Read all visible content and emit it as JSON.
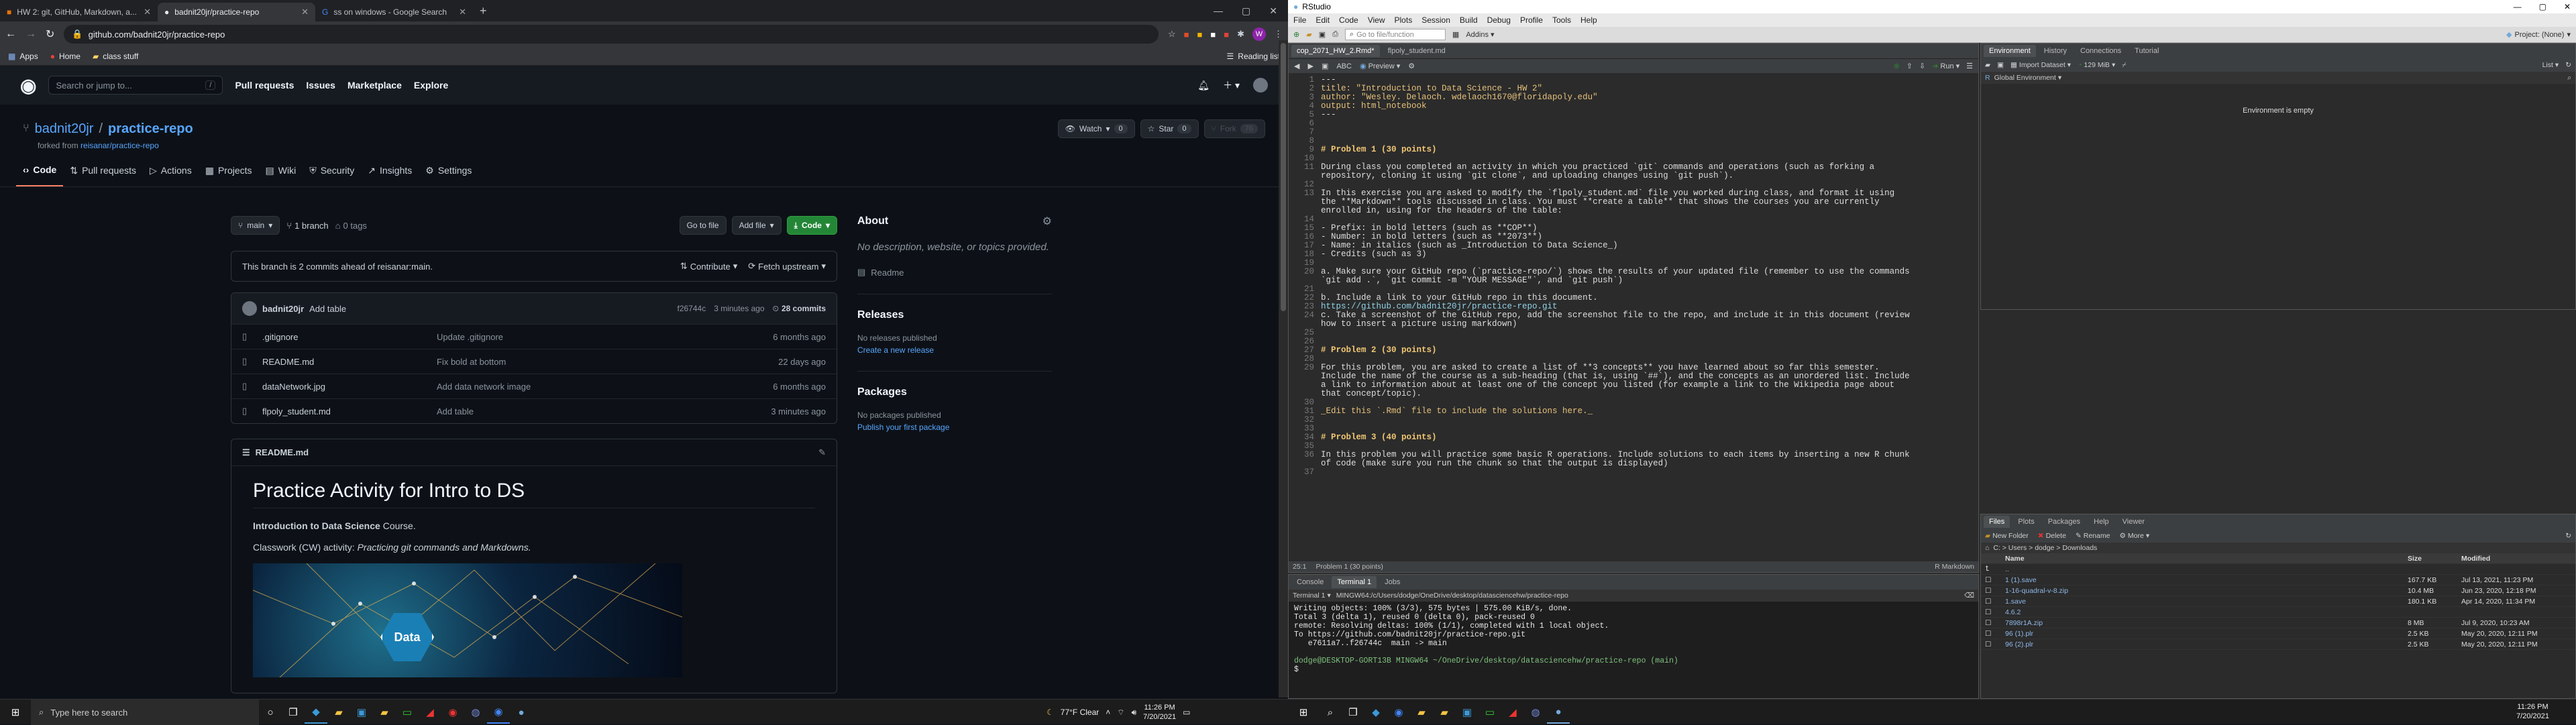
{
  "chrome": {
    "tabs": [
      {
        "label": "HW 2: git, GitHub, Markdown, a..."
      },
      {
        "label": "badnit20jr/practice-repo"
      },
      {
        "label": "ss on windows - Google Search"
      }
    ],
    "url": "github.com/badnit20jr/practice-repo",
    "bookmarks": [
      "Apps",
      "Home",
      "class stuff"
    ],
    "reading_list": "Reading list"
  },
  "gh": {
    "search_placeholder": "Search or jump to...",
    "search_key": "/",
    "nav": [
      "Pull requests",
      "Issues",
      "Marketplace",
      "Explore"
    ],
    "owner": "badnit20jr",
    "sep": "/",
    "repo": "practice-repo",
    "forked_prefix": "forked from",
    "forked_from": "reisanar/practice-repo",
    "watch": "Watch",
    "watch_count": "0",
    "star": "Star",
    "star_count": "0",
    "fork": "Fork",
    "fork_count": "76",
    "tabs": [
      "Code",
      "Pull requests",
      "Actions",
      "Projects",
      "Wiki",
      "Security",
      "Insights",
      "Settings"
    ],
    "branch": "main",
    "branches": "1 branch",
    "tags": "0 tags",
    "goto": "Go to file",
    "addfile": "Add file",
    "code": "Code",
    "ahead": "This branch is 2 commits ahead of reisanar:main.",
    "contribute": "Contribute",
    "fetch": "Fetch upstream",
    "commit_user": "badnit20jr",
    "commit_msg": "Add table",
    "commit_hash": "f26744c",
    "commit_time": "3 minutes ago",
    "commits": "28 commits",
    "files": [
      {
        "name": ".gitignore",
        "msg": "Update .gitignore",
        "time": "6 months ago"
      },
      {
        "name": "README.md",
        "msg": "Fix bold at bottom",
        "time": "22 days ago"
      },
      {
        "name": "dataNetwork.jpg",
        "msg": "Add data network image",
        "time": "6 months ago"
      },
      {
        "name": "flpoly_student.md",
        "msg": "Add table",
        "time": "3 minutes ago"
      }
    ],
    "readme_name": "README.md",
    "readme_h1": "Practice Activity for Intro to DS",
    "readme_p1_bold": "Introduction to Data Science",
    "readme_p1_rest": " Course.",
    "readme_p2_a": "Classwork (CW) activity: ",
    "readme_p2_em": "Practicing git commands and Markdowns.",
    "about": "About",
    "about_desc": "No description, website, or topics provided.",
    "readme_link": "Readme",
    "releases": "Releases",
    "no_releases": "No releases published",
    "create_release": "Create a new release",
    "packages": "Packages",
    "no_packages": "No packages published",
    "publish_pkg": "Publish your first package",
    "img_label": "Data"
  },
  "rs": {
    "title": "RStudio",
    "menu": [
      "File",
      "Edit",
      "Code",
      "View",
      "Plots",
      "Session",
      "Build",
      "Debug",
      "Profile",
      "Tools",
      "Help"
    ],
    "goto": "Go to file/function",
    "addins": "Addins",
    "project": "Project: (None)",
    "editor_tabs": [
      "cop_2071_HW_2.Rmd*",
      "flpoly_student.md"
    ],
    "preview": "Preview",
    "run": "Run",
    "lines": [
      {
        "n": "1",
        "t": "---",
        "c": ""
      },
      {
        "n": "2",
        "t": "title: \"Introduction to Data Science - HW 2\"",
        "c": "yl"
      },
      {
        "n": "3",
        "t": "author: \"Wesley. Delaoch. wdelaoch1670@floridapoly.edu\"",
        "c": "yl"
      },
      {
        "n": "4",
        "t": "output: html_notebook",
        "c": "yl"
      },
      {
        "n": "5",
        "t": "---",
        "c": ""
      },
      {
        "n": "6",
        "t": "",
        "c": ""
      },
      {
        "n": "7",
        "t": "",
        "c": ""
      },
      {
        "n": "8",
        "t": "",
        "c": ""
      },
      {
        "n": "9",
        "t": "# Problem 1 (30 points)",
        "c": "h"
      },
      {
        "n": "10",
        "t": "",
        "c": ""
      },
      {
        "n": "11",
        "t": "During class you completed an activity in which you practiced `git` commands and operations (such as forking a",
        "c": ""
      },
      {
        "n": "",
        "t": "repository, cloning it using `git clone`, and uploading changes using `git push`).",
        "c": ""
      },
      {
        "n": "12",
        "t": "",
        "c": ""
      },
      {
        "n": "13",
        "t": "In this exercise you are asked to modify the `flpoly_student.md` file you worked during class, and format it using",
        "c": ""
      },
      {
        "n": "",
        "t": "the **Markdown** tools discussed in class. You must **create a table** that shows the courses you are currently",
        "c": ""
      },
      {
        "n": "",
        "t": "enrolled in, using for the headers of the table:",
        "c": ""
      },
      {
        "n": "14",
        "t": "",
        "c": ""
      },
      {
        "n": "15",
        "t": "- Prefix: in bold letters (such as **COP**)",
        "c": ""
      },
      {
        "n": "16",
        "t": "- Number: in bold letters (such as **2073**)",
        "c": ""
      },
      {
        "n": "17",
        "t": "- Name: in italics (such as _Introduction to Data Science_)",
        "c": ""
      },
      {
        "n": "18",
        "t": "- Credits (such as 3)",
        "c": ""
      },
      {
        "n": "19",
        "t": "",
        "c": ""
      },
      {
        "n": "20",
        "t": "a. Make sure your GitHub repo (`practice-repo/`) shows the results of your updated file (remember to use the commands",
        "c": ""
      },
      {
        "n": "",
        "t": "`git add .`, `git commit -m \"YOUR MESSAGE\"`, and `git push`)",
        "c": ""
      },
      {
        "n": "21",
        "t": "",
        "c": ""
      },
      {
        "n": "22",
        "t": "b. Include a link to your GitHub repo in this document.",
        "c": ""
      },
      {
        "n": "23",
        "t": "https://github.com/badnit20jr/practice-repo.git",
        "c": "cy"
      },
      {
        "n": "24",
        "t": "c. Take a screenshot of the GitHub repo, add the screenshot file to the repo, and include it in this document (review",
        "c": ""
      },
      {
        "n": "",
        "t": "how to insert a picture using markdown)",
        "c": ""
      },
      {
        "n": "25",
        "t": "",
        "c": ""
      },
      {
        "n": "26",
        "t": "",
        "c": ""
      },
      {
        "n": "27",
        "t": "# Problem 2 (30 points)",
        "c": "h"
      },
      {
        "n": "28",
        "t": "",
        "c": ""
      },
      {
        "n": "29",
        "t": "For this problem, you are asked to create a list of **3 concepts** you have learned about so far this semester.",
        "c": ""
      },
      {
        "n": "",
        "t": "Include the name of the course as a sub-heading (that is, using `##`), and the concepts as an unordered list. Include",
        "c": ""
      },
      {
        "n": "",
        "t": "a link to information about at least one of the concept you listed (for example a link to the Wikipedia page about",
        "c": ""
      },
      {
        "n": "",
        "t": "that concept/topic).",
        "c": ""
      },
      {
        "n": "30",
        "t": "",
        "c": ""
      },
      {
        "n": "31",
        "t": "_Edit this `.Rmd` file to include the solutions here._",
        "c": "yl"
      },
      {
        "n": "32",
        "t": "",
        "c": ""
      },
      {
        "n": "33",
        "t": "",
        "c": ""
      },
      {
        "n": "34",
        "t": "# Problem 3 (40 points)",
        "c": "h"
      },
      {
        "n": "35",
        "t": "",
        "c": ""
      },
      {
        "n": "36",
        "t": "In this problem you will practice some basic R operations. Include solutions to each items by inserting a new R chunk",
        "c": ""
      },
      {
        "n": "",
        "t": "of code (make sure you run the chunk so that the output is displayed)",
        "c": ""
      },
      {
        "n": "37",
        "t": "",
        "c": ""
      }
    ],
    "editor_status_left": "25:1",
    "editor_status_mid": "Problem 1 (30 points)",
    "editor_status_right": "R Markdown",
    "console_tabs": [
      "Console",
      "Terminal 1",
      "Jobs"
    ],
    "term_tab": "Terminal 1",
    "term_path": "MINGW64:/c/Users/dodge/OneDrive/desktop/datasciencehw/practice-repo",
    "term_lines": [
      "Writing objects: 100% (3/3), 575 bytes | 575.00 KiB/s, done.",
      "Total 3 (delta 1), reused 0 (delta 0), pack-reused 0",
      "remote: Resolving deltas: 100% (1/1), completed with 1 local object.",
      "To https://github.com/badnit20jr/practice-repo.git",
      "   e7611a7..f26744c  main -> main",
      "",
      "dodge@DESKTOP-GORT13B MINGW64 ~/OneDrive/desktop/datasciencehw/practice-repo (main)",
      "$ "
    ],
    "env_tabs": [
      "Environment",
      "History",
      "Connections",
      "Tutorial"
    ],
    "import": "Import Dataset",
    "mem": "129 MiB",
    "list": "List",
    "global": "Global Environment",
    "env_empty": "Environment is empty",
    "files_tabs": [
      "Files",
      "Plots",
      "Packages",
      "Help",
      "Viewer"
    ],
    "files_tool": [
      "New Folder",
      "Delete",
      "Rename",
      "More"
    ],
    "breadcrumb": "C: > Users > dodge > Downloads",
    "files_cols": [
      "Name",
      "Size",
      "Modified"
    ],
    "files": [
      {
        "name": "..",
        "size": "",
        "mod": ""
      },
      {
        "name": "1 (1).save",
        "size": "167.7 KB",
        "mod": "Jul 13, 2021, 11:23 PM"
      },
      {
        "name": "1-16-quadral-v-8.zip",
        "size": "10.4 MB",
        "mod": "Jun 23, 2020, 12:18 PM"
      },
      {
        "name": "1.save",
        "size": "180.1 KB",
        "mod": "Apr 14, 2020, 11:34 PM"
      },
      {
        "name": "4.6.2",
        "size": "",
        "mod": ""
      },
      {
        "name": "7898r1A.zip",
        "size": "8 MB",
        "mod": "Jul 9, 2020, 10:23 AM"
      },
      {
        "name": "96 (1).plr",
        "size": "2.5 KB",
        "mod": "May 20, 2020, 12:11 PM"
      },
      {
        "name": "96 (2).plr",
        "size": "2.5 KB",
        "mod": "May 20, 2020, 12:11 PM"
      }
    ]
  },
  "taskbar": {
    "search": "Type here to search",
    "weather": "77°F  Clear",
    "time1": "11:26 PM",
    "date1": "7/20/2021",
    "time2": "11:26 PM",
    "date2": "7/20/2021"
  },
  "colors": {
    "gh_bg": "#0d1117",
    "accent_green": "#238636",
    "link": "#58a6ff",
    "rs_bg": "#2b2b2b"
  }
}
